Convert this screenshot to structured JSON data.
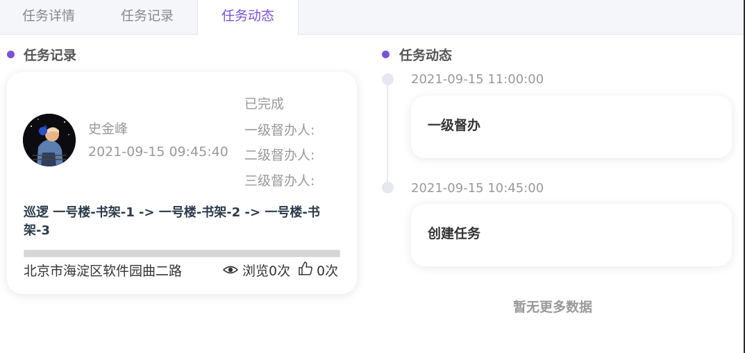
{
  "tabs": [
    {
      "label": "任务详情"
    },
    {
      "label": "任务记录"
    },
    {
      "label": "任务动态"
    }
  ],
  "active_tab": "任务动态",
  "accent_color": "#7b4fe0",
  "record": {
    "section_title": "任务记录",
    "user_name": "史金峰",
    "time": "2021-09-15 09:45:40",
    "status": "已完成",
    "supervisor1": "一级督办人:",
    "supervisor2": "二级督办人:",
    "supervisor3": "三级督办人:",
    "description": "巡逻 一号楼-书架-1 -> 一号楼-书架-2 -> 一号楼-书架-3",
    "address": "北京市海淀区软件园曲二路",
    "views": "浏览0次",
    "likes": "0次",
    "icons": [
      "eye-icon",
      "thumbs-up-icon"
    ]
  },
  "dynamics": {
    "section_title": "任务动态",
    "items": [
      {
        "time": "2021-09-15 11:00:00",
        "text": "一级督办"
      },
      {
        "time": "2021-09-15 10:45:00",
        "text": "创建任务"
      }
    ],
    "no_more": "暂无更多数据"
  }
}
